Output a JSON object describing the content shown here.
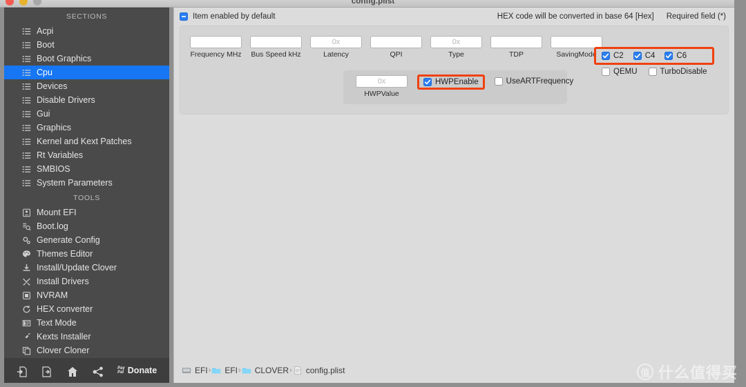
{
  "window": {
    "title": "config.plist",
    "traffic_lights": [
      "close",
      "minimize",
      "zoom"
    ]
  },
  "sidebar": {
    "sections_header": "SECTIONS",
    "tools_header": "TOOLS",
    "sections": [
      {
        "label": "Acpi",
        "icon": "list-icon",
        "active": false
      },
      {
        "label": "Boot",
        "icon": "list-icon",
        "active": false
      },
      {
        "label": "Boot Graphics",
        "icon": "list-icon",
        "active": false
      },
      {
        "label": "Cpu",
        "icon": "list-icon",
        "active": true
      },
      {
        "label": "Devices",
        "icon": "list-icon",
        "active": false
      },
      {
        "label": "Disable Drivers",
        "icon": "list-icon",
        "active": false
      },
      {
        "label": "Gui",
        "icon": "list-icon",
        "active": false
      },
      {
        "label": "Graphics",
        "icon": "list-icon",
        "active": false
      },
      {
        "label": "Kernel and Kext Patches",
        "icon": "list-icon",
        "active": false
      },
      {
        "label": "Rt Variables",
        "icon": "list-icon",
        "active": false
      },
      {
        "label": "SMBIOS",
        "icon": "list-icon",
        "active": false
      },
      {
        "label": "System Parameters",
        "icon": "list-icon",
        "active": false
      }
    ],
    "tools": [
      {
        "label": "Mount EFI",
        "icon": "mount-efi-icon"
      },
      {
        "label": "Boot.log",
        "icon": "boot-log-icon"
      },
      {
        "label": "Generate Config",
        "icon": "gear-icon"
      },
      {
        "label": "Themes Editor",
        "icon": "palette-icon"
      },
      {
        "label": "Install/Update Clover",
        "icon": "download-icon"
      },
      {
        "label": "Install Drivers",
        "icon": "tools-icon"
      },
      {
        "label": "NVRAM",
        "icon": "chip-icon"
      },
      {
        "label": "HEX converter",
        "icon": "refresh-icon"
      },
      {
        "label": "Text Mode",
        "icon": "text-mode-icon"
      },
      {
        "label": "Kexts Installer",
        "icon": "plug-icon"
      },
      {
        "label": "Clover Cloner",
        "icon": "copy-icon"
      }
    ]
  },
  "toolbar": {
    "buttons": [
      {
        "name": "import-button",
        "icon": "import-icon"
      },
      {
        "name": "export-button",
        "icon": "export-icon"
      },
      {
        "name": "home-button",
        "icon": "home-icon"
      },
      {
        "name": "share-button",
        "icon": "share-icon"
      }
    ],
    "donate_label": "Donate",
    "paypal_line1": "Pay",
    "paypal_line2": "Pal"
  },
  "header": {
    "item_enabled_label": "Item enabled by default",
    "item_enabled_state": "mixed",
    "hex_note": "HEX code will be converted in base 64 [Hex]",
    "required_note": "Required field (*)"
  },
  "form": {
    "fields": [
      {
        "label": "Frequency MHz",
        "value": "",
        "placeholder": ""
      },
      {
        "label": "Bus Speed kHz",
        "value": "",
        "placeholder": ""
      },
      {
        "label": "Latency",
        "value": "",
        "placeholder": "0x"
      },
      {
        "label": "QPI",
        "value": "",
        "placeholder": ""
      },
      {
        "label": "Type",
        "value": "",
        "placeholder": "0x"
      },
      {
        "label": "TDP",
        "value": "",
        "placeholder": ""
      },
      {
        "label": "SavingMode",
        "value": "",
        "placeholder": ""
      }
    ],
    "cstates": [
      {
        "label": "C2",
        "checked": true
      },
      {
        "label": "C4",
        "checked": true
      },
      {
        "label": "C6",
        "checked": true
      }
    ],
    "extra_flags": [
      {
        "label": "QEMU",
        "checked": false
      },
      {
        "label": "TurboDisable",
        "checked": false
      }
    ],
    "hwp": {
      "value_label": "HWPValue",
      "value": "",
      "value_placeholder": "0x",
      "enable_label": "HWPEnable",
      "enable_checked": true,
      "useart_label": "UseARTFrequency",
      "useart_checked": false
    }
  },
  "breadcrumb": [
    {
      "label": "EFI",
      "icon": "disk-icon"
    },
    {
      "label": "EFI",
      "icon": "folder-icon"
    },
    {
      "label": "CLOVER",
      "icon": "folder-icon"
    },
    {
      "label": "config.plist",
      "icon": "file-icon"
    }
  ],
  "breadcrumb_separator": "›",
  "watermark": {
    "logo": "值",
    "text": "什么值得买"
  },
  "colors": {
    "accent_blue": "#1676f3",
    "highlight_red": "#f0400f",
    "checkbox_blue": "#2a7ef1",
    "sidebar_bg": "#4a4a4a",
    "content_bg": "#dcdcdc"
  }
}
